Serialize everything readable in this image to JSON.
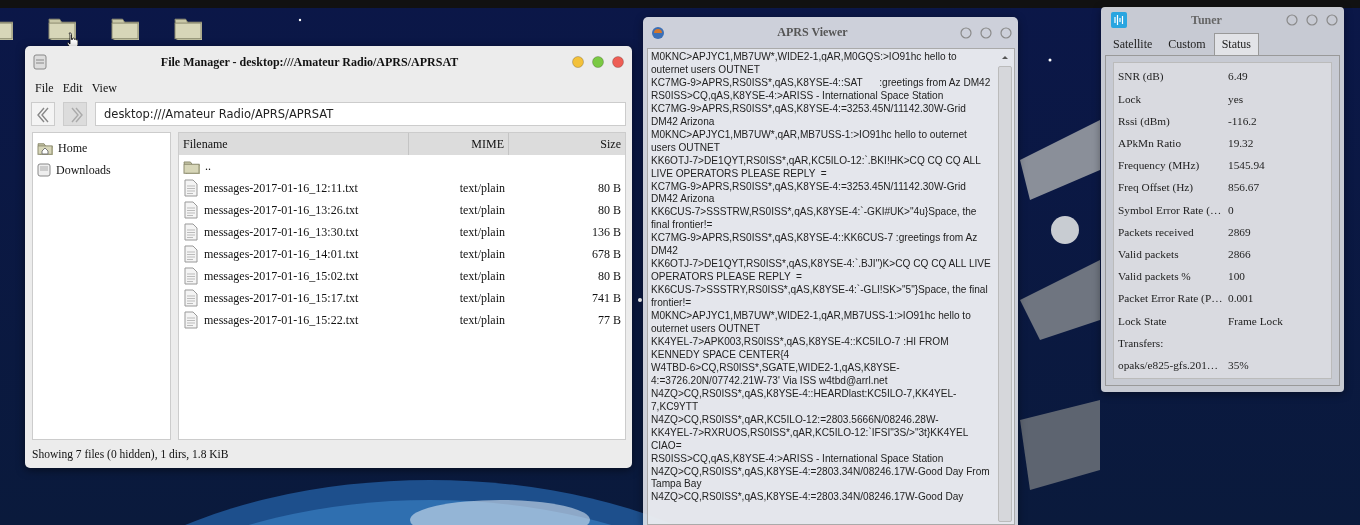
{
  "file_manager": {
    "title": "File Manager - desktop:///Amateur Radio/APRS/APRSAT",
    "menu": [
      "File",
      "Edit",
      "View"
    ],
    "back": {
      "disabled": false
    },
    "forward": {
      "disabled": true
    },
    "address": "desktop:///Amateur Radio/APRS/APRSAT",
    "sidebar": [
      {
        "label": "Home",
        "kind": "home"
      },
      {
        "label": "Downloads",
        "kind": "drive"
      }
    ],
    "columns": [
      "Filename",
      "MIME",
      "Size"
    ],
    "rows": [
      {
        "kind": "folder",
        "name": ".."
      },
      {
        "kind": "file",
        "name": "messages-2017-01-16_12:11.txt",
        "mime": "text/plain",
        "size": "80 B"
      },
      {
        "kind": "file",
        "name": "messages-2017-01-16_13:26.txt",
        "mime": "text/plain",
        "size": "80 B"
      },
      {
        "kind": "file",
        "name": "messages-2017-01-16_13:30.txt",
        "mime": "text/plain",
        "size": "136 B"
      },
      {
        "kind": "file",
        "name": "messages-2017-01-16_14:01.txt",
        "mime": "text/plain",
        "size": "678 B"
      },
      {
        "kind": "file",
        "name": "messages-2017-01-16_15:02.txt",
        "mime": "text/plain",
        "size": "80 B"
      },
      {
        "kind": "file",
        "name": "messages-2017-01-16_15:17.txt",
        "mime": "text/plain",
        "size": "741 B"
      },
      {
        "kind": "file",
        "name": "messages-2017-01-16_15:22.txt",
        "mime": "text/plain",
        "size": "77 B"
      }
    ],
    "status_bar": "Showing 7 files (0 hidden), 1 dirs, 1.8 KiB"
  },
  "aprs_viewer": {
    "title": "APRS Viewer",
    "messages": [
      "M0KNC>APJYC1,MB7UW*,WIDE2-1,qAR,M0GQS:>IO91hc hello to outernet users OUTNET",
      "KC7MG-9>APRS,RS0ISS*,qAS,K8YSE-4::SAT      :greetings from Az DM42",
      "RS0ISS>CQ,qAS,K8YSE-4:>ARISS - International Space Station",
      "KC7MG-9>APRS,RS0ISS*,qAS,K8YSE-4:=3253.45N/11142.30W-Grid DM42 Arizona",
      "M0KNC>APJYC1,MB7UW*,qAR,MB7USS-1:>IO91hc hello to outernet users OUTNET",
      "KK6OTJ-7>DE1QYT,RS0ISS*,qAR,KC5ILO-12:`.BKI!HK>CQ CQ CQ ALL LIVE OPERATORS PLEASE REPLY  =",
      "KC7MG-9>APRS,RS0ISS*,qAS,K8YSE-4:=3253.45N/11142.30W-Grid DM42 Arizona",
      "KK6CUS-7>SSSTRW,RS0ISS*,qAS,K8YSE-4:`-GKI#UK>\"4u}Space, the final frontier!=",
      "KC7MG-9>APRS,RS0ISS*,qAS,K8YSE-4::KK6CUS-7 :greetings from Az DM42",
      "KK6OTJ-7>DE1QYT,RS0ISS*,qAS,K8YSE-4:`.BJI\")K>CQ CQ CQ ALL LIVE OPERATORS PLEASE REPLY  =",
      "KK6CUS-7>SSSTRY,RS0ISS*,qAS,K8YSE-4:`-GLI!SK>\"5\"}Space, the final frontier!=",
      "M0KNC>APJYC1,MB7UW*,WIDE2-1,qAR,MB7USS-1:>IO91hc hello to outernet users OUTNET",
      "KK4YEL-7>APK003,RS0ISS*,qAS,K8YSE-4::KC5ILO-7 :HI FROM KENNEDY SPACE CENTER{4",
      "W4TBD-6>CQ,RS0ISS*,SGATE,WIDE2-1,qAS,K8YSE-4:=3726.20N/07742.21W-73' Via ISS w4tbd@arrl.net",
      "N4ZQ>CQ,RS0ISS*,qAS,K8YSE-4::HEARDlast:KC5ILO-7,KK4YEL-7,KC9YTT",
      "N4ZQ>CQ,RS0ISS*,qAR,KC5ILO-12:=2803.5666N/08246.28W-",
      "KK4YEL-7>RXRUOS,RS0ISS*,qAR,KC5ILO-12:`IFSI\"3S/>\"3t}KK4YEL CIAO=",
      "RS0ISS>CQ,qAS,K8YSE-4:>ARISS - International Space Station",
      "N4ZQ>CQ,RS0ISS*,qAS,K8YSE-4:=2803.34N/08246.17W-Good Day From Tampa Bay",
      "N4ZQ>CQ,RS0ISS*,qAS,K8YSE-4:=2803.34N/08246.17W-Good Day"
    ]
  },
  "tuner": {
    "title": "Tuner",
    "tabs": [
      {
        "label": "Satellite",
        "selected": false
      },
      {
        "label": "Custom",
        "selected": false
      },
      {
        "label": "Status",
        "selected": true
      }
    ],
    "rows": [
      {
        "label": "SNR (dB)",
        "value": "6.49"
      },
      {
        "label": "Lock",
        "value": "yes"
      },
      {
        "label": "Rssi (dBm)",
        "value": "-116.2"
      },
      {
        "label": "APkMn Ratio",
        "value": "19.32"
      },
      {
        "label": "Frequency (MHz)",
        "value": "1545.94"
      },
      {
        "label": "Freq Offset (Hz)",
        "value": "856.67"
      },
      {
        "label": "Symbol Error Rate (…",
        "value": "0"
      },
      {
        "label": "Packets received",
        "value": "2869"
      },
      {
        "label": "Valid packets",
        "value": "2866"
      },
      {
        "label": "Valid packets %",
        "value": "100"
      },
      {
        "label": "Packet Error Rate (P…",
        "value": "0.001"
      },
      {
        "label": "Lock State",
        "value": "Frame Lock"
      },
      {
        "label": "Transfers:"
      },
      {
        "label": "opaks/e825-gfs.201…",
        "value": "35%"
      }
    ]
  }
}
